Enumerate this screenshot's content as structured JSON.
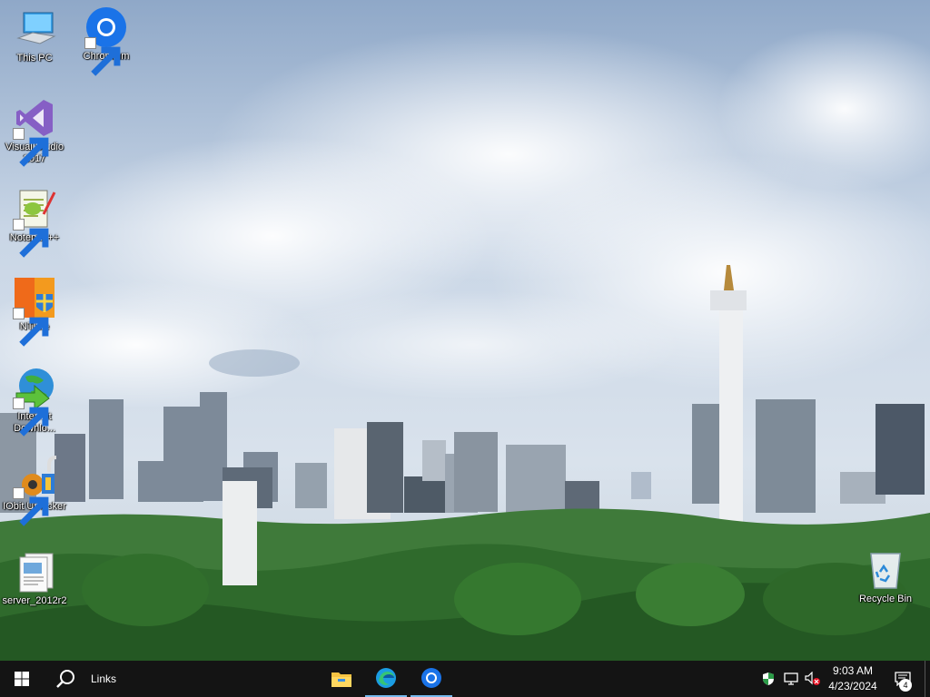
{
  "desktop": {
    "icons": [
      {
        "label": "This PC",
        "icon": "computer-icon"
      },
      {
        "label": "Chromium",
        "icon": "chromium-icon"
      },
      {
        "label": "Visual Studio 2017",
        "icon": "visual-studio-icon"
      },
      {
        "label": "Notepad++",
        "icon": "notepad-plus-plus-icon"
      },
      {
        "label": "NTLite",
        "icon": "ntlite-icon"
      },
      {
        "label": "Internet Downlo...",
        "icon": "internet-download-manager-icon"
      },
      {
        "label": "IObit Unlocker",
        "icon": "iobit-unlocker-icon"
      },
      {
        "label": "server_2012r2",
        "icon": "server-image-icon"
      },
      {
        "label": "Recycle Bin",
        "icon": "recycle-bin-icon"
      }
    ]
  },
  "taskbar": {
    "search_label": "Links",
    "pinned": [
      {
        "name": "file-explorer",
        "icon": "folder-icon",
        "running": false
      },
      {
        "name": "edge",
        "icon": "edge-icon",
        "running": true
      },
      {
        "name": "chromium",
        "icon": "chromium-icon",
        "running": true
      }
    ],
    "clock": {
      "time": "9:03 AM",
      "date": "4/23/2024"
    },
    "notifications_count": "4",
    "colors": {
      "background": "#141414",
      "accent": "#76b9ed"
    }
  }
}
